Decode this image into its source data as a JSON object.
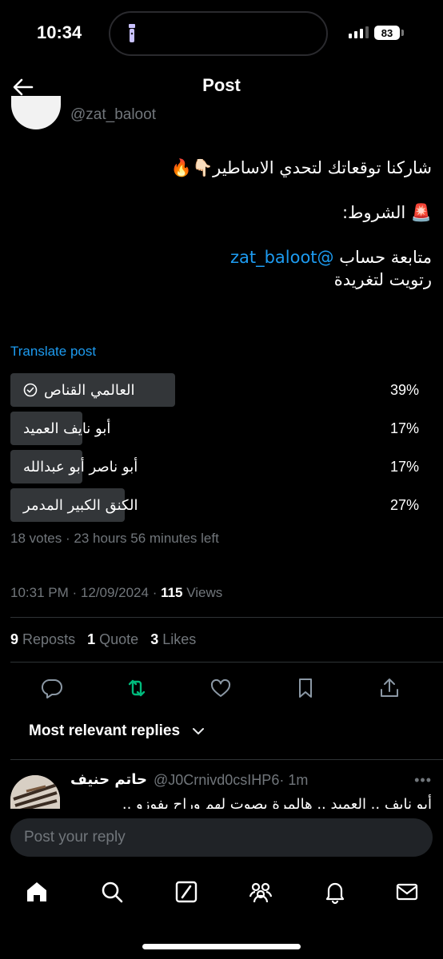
{
  "status_bar": {
    "time": "10:34",
    "battery": "83"
  },
  "header": {
    "title": "Post",
    "back_icon": "arrow-left-icon"
  },
  "author": {
    "handle": "@zat_baloot"
  },
  "post": {
    "line1": "شاركنا توقعاتك لتحدي الاساطير👇🏻🔥",
    "line2": "🚨 الشروط:",
    "line3_prefix": "متابعة حساب ",
    "line3_mention": "@zat_baloot",
    "line4": "رتويت لتغريدة",
    "translate_label": "Translate post"
  },
  "poll": {
    "options": [
      {
        "label": "العالمي القناص",
        "percent_text": "39%",
        "percent": 39,
        "selected": true
      },
      {
        "label": "أبو نايف العميد",
        "percent_text": "17%",
        "percent": 17,
        "selected": false
      },
      {
        "label": "أبو ناصر أبو عبدالله",
        "percent_text": "17%",
        "percent": 17,
        "selected": false
      },
      {
        "label": "الكنق الكبير المدمر",
        "percent_text": "27%",
        "percent": 27,
        "selected": false
      }
    ],
    "meta": "18 votes · 23 hours 56 minutes left"
  },
  "post_meta": {
    "time": "10:31 PM",
    "date": "12/09/2024",
    "views_count": "115",
    "views_label": "Views"
  },
  "stats": {
    "reposts_count": "9",
    "reposts_label": "Reposts",
    "quotes_count": "1",
    "quotes_label": "Quote",
    "likes_count": "3",
    "likes_label": "Likes"
  },
  "actions": [
    "reply-icon",
    "repost-icon",
    "like-icon",
    "bookmark-icon",
    "share-icon"
  ],
  "colors": {
    "accent": "#1d9bf0",
    "repost_active": "#00ba7c",
    "muted": "#71767b",
    "poll_bar": "#333639"
  },
  "replies": {
    "sort_label": "Most relevant replies",
    "items": [
      {
        "name": "حاتم حنيف",
        "handle": "@J0Crnivd0csIHP6",
        "time": "· 1m",
        "text": "أبو نايف .. العميد .. هالمرة بصوت لهم وراح يفوزو .."
      }
    ]
  },
  "composer": {
    "placeholder": "Post your reply"
  },
  "bottom_nav": [
    "home-icon",
    "search-icon",
    "grok-icon",
    "communities-icon",
    "notifications-icon",
    "messages-icon"
  ]
}
